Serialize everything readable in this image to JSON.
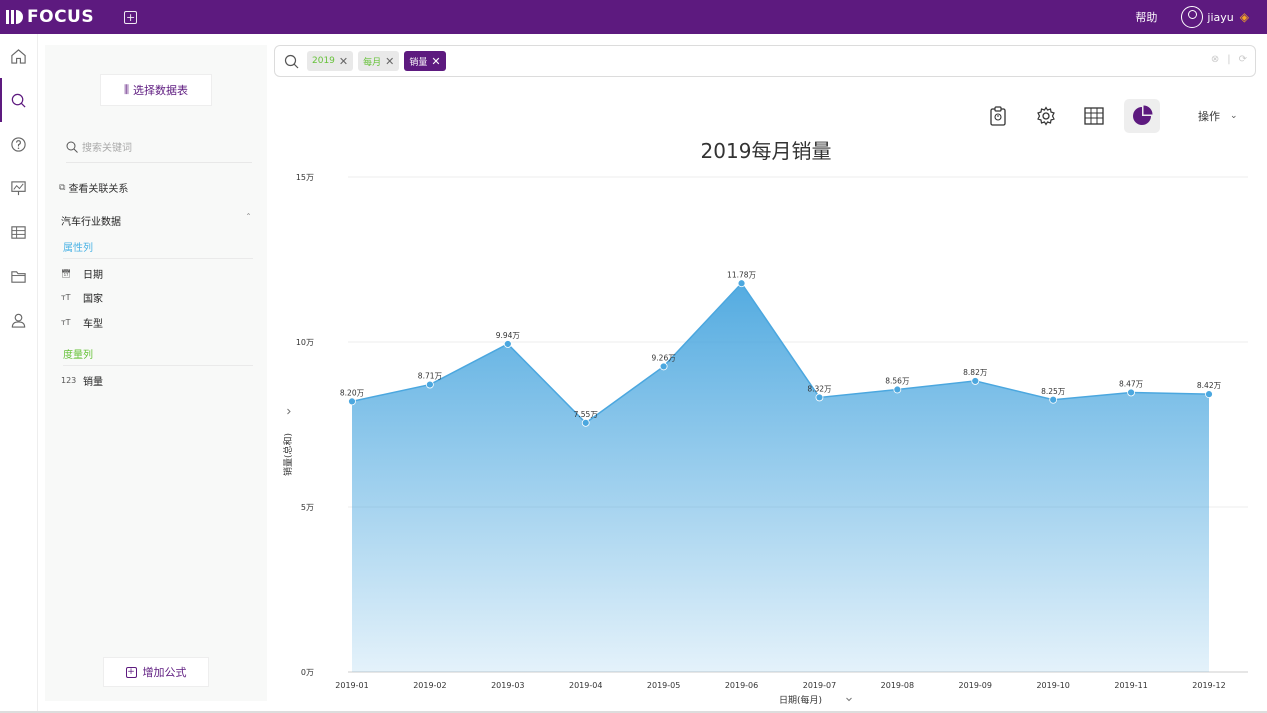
{
  "app": {
    "logo_text": "FOCUS",
    "help": "帮助",
    "username": "jiayu"
  },
  "rail": [
    "home-icon",
    "search-icon",
    "help-circle-icon",
    "presentation-icon",
    "table-icon",
    "folder-icon",
    "user-icon"
  ],
  "panel": {
    "choose_table": "选择数据表",
    "search_placeholder": "搜索关键词",
    "view_relations": "查看关联关系",
    "group_title": "汽车行业数据",
    "attr_label": "属性列",
    "measure_label": "度量列",
    "attr_items": [
      {
        "icon": "calendar",
        "label": "日期"
      },
      {
        "icon": "text",
        "label": "国家"
      },
      {
        "icon": "text",
        "label": "车型"
      }
    ],
    "measure_items": [
      {
        "icon": "123",
        "label": "销量"
      }
    ],
    "add_formula": "增加公式"
  },
  "search": {
    "tokens": [
      "2019",
      "每月",
      "销量"
    ]
  },
  "toolbar": {
    "ops_label": "操作"
  },
  "colors": {
    "brand": "#5d1a7f",
    "series": "#4ba7df",
    "attr": "#4bb3e5",
    "measure": "#67c23a"
  },
  "chart_data": {
    "type": "area",
    "title": "2019每月销量",
    "xlabel": "日期(每月)",
    "ylabel": "销量(总和)",
    "categories": [
      "2019-01",
      "2019-02",
      "2019-03",
      "2019-04",
      "2019-05",
      "2019-06",
      "2019-07",
      "2019-08",
      "2019-09",
      "2019-10",
      "2019-11",
      "2019-12"
    ],
    "values": [
      8.2,
      8.71,
      9.94,
      7.55,
      9.26,
      11.78,
      8.32,
      8.56,
      8.82,
      8.25,
      8.47,
      8.42
    ],
    "data_labels": [
      "8.20万",
      "8.71万",
      "9.94万",
      "7.55万",
      "9.26万",
      "11.78万",
      "8.32万",
      "8.56万",
      "8.82万",
      "8.25万",
      "8.47万",
      "8.42万"
    ],
    "yticks": [
      {
        "v": 0,
        "label": "0万"
      },
      {
        "v": 5,
        "label": "5万"
      },
      {
        "v": 10,
        "label": "10万"
      },
      {
        "v": 15,
        "label": "15万"
      }
    ],
    "ylim": [
      0,
      15
    ],
    "grid": true
  }
}
